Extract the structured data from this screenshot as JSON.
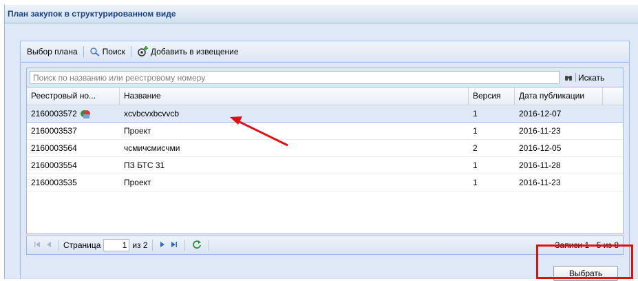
{
  "window": {
    "title": "План закупок в структурированном виде"
  },
  "toolbar": {
    "select_plan": "Выбор плана",
    "search": "Поиск",
    "add_to_notice": "Добавить в извещение"
  },
  "search": {
    "placeholder": "Поиск по названию или реестровому номеру",
    "button": "Искать"
  },
  "table": {
    "columns": [
      "Реестровый но...",
      "Название",
      "Версия",
      "Дата публикации"
    ],
    "rows": [
      {
        "reg": "2160003572",
        "name": "xcvbcvxbcvvcb",
        "version": "1",
        "date": "2016-12-07",
        "selected": true
      },
      {
        "reg": "2160003537",
        "name": "Проект",
        "version": "1",
        "date": "2016-11-23"
      },
      {
        "reg": "2160003564",
        "name": "чсмичсмисчми",
        "version": "2",
        "date": "2016-12-05"
      },
      {
        "reg": "2160003554",
        "name": "ПЗ БТС 31",
        "version": "1",
        "date": "2016-11-28"
      },
      {
        "reg": "2160003535",
        "name": "Проект",
        "version": "1",
        "date": "2016-11-23"
      }
    ]
  },
  "pager": {
    "page_label": "Страница",
    "current_page": "1",
    "of_total": "из 2",
    "records": "Записи 1 - 5 из 8"
  },
  "footer": {
    "select_button": "Выбрать"
  },
  "colors": {
    "annotation": "#e01010",
    "accent": "#15428b",
    "selection": "#dfe8f6"
  },
  "icons": [
    "search-icon",
    "add-plan-icon",
    "binoculars-icon",
    "status-icon",
    "first-page-icon",
    "prev-page-icon",
    "next-page-icon",
    "last-page-icon",
    "refresh-icon"
  ]
}
